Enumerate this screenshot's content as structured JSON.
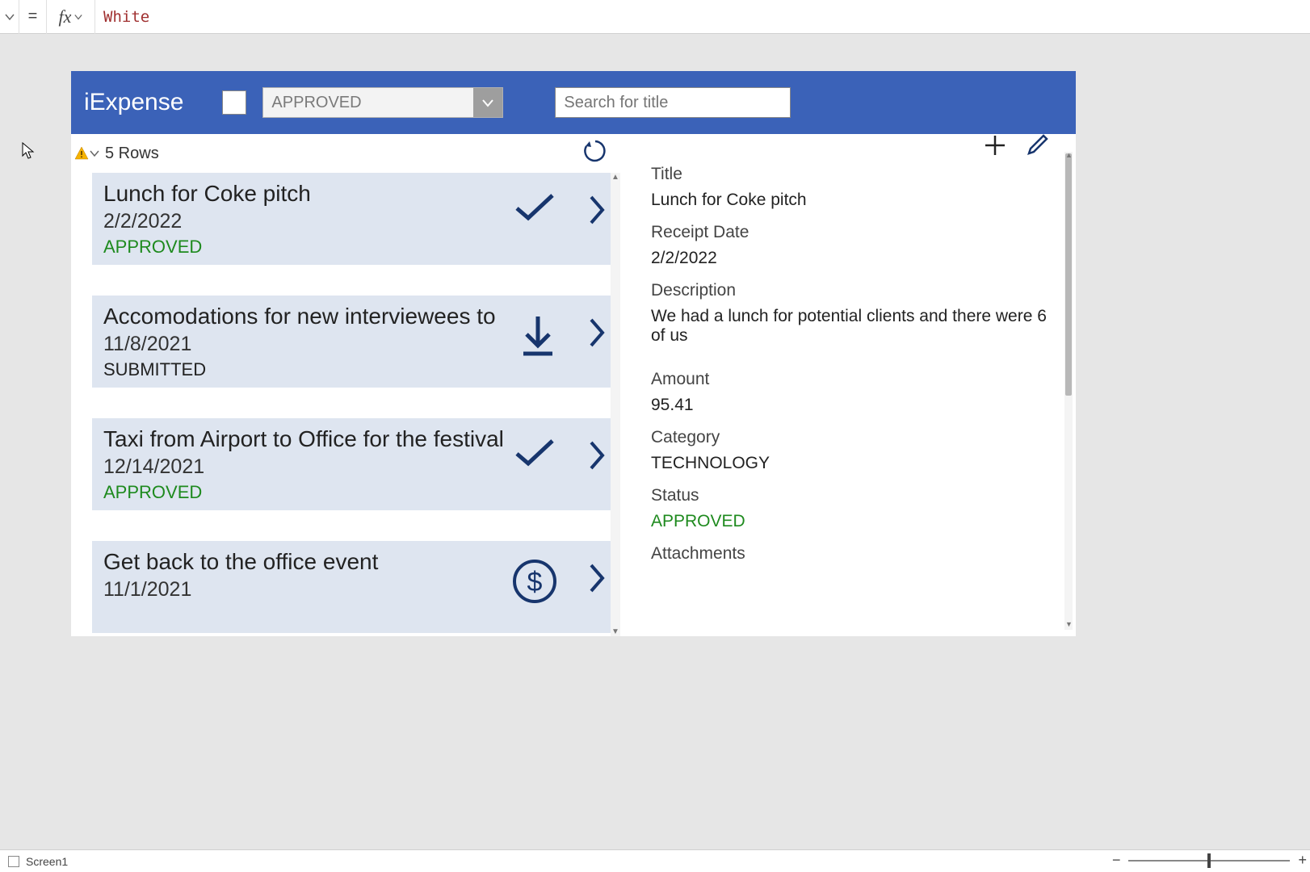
{
  "formula_bar": {
    "value": "White"
  },
  "app": {
    "title": "iExpense",
    "filter_dropdown": "APPROVED",
    "search_placeholder": "Search for title"
  },
  "list": {
    "rows_label": "5 Rows",
    "items": [
      {
        "title": "Lunch for Coke pitch",
        "date": "2/2/2022",
        "status": "APPROVED",
        "status_style": "approved",
        "icon": "check"
      },
      {
        "title": "Accomodations for new interviewees to",
        "date": "11/8/2021",
        "status": "SUBMITTED",
        "status_style": "default",
        "icon": "download"
      },
      {
        "title": "Taxi from Airport to Office for the festival",
        "date": "12/14/2021",
        "status": "APPROVED",
        "status_style": "approved",
        "icon": "check"
      },
      {
        "title": "Get back to the office event",
        "date": "11/1/2021",
        "status": "",
        "status_style": "default",
        "icon": "dollar"
      }
    ]
  },
  "detail": {
    "fields": {
      "title_label": "Title",
      "title_value": "Lunch for Coke pitch",
      "date_label": "Receipt Date",
      "date_value": "2/2/2022",
      "desc_label": "Description",
      "desc_value": "We had a lunch for potential clients and there were 6 of us",
      "amount_label": "Amount",
      "amount_value": "95.41",
      "category_label": "Category",
      "category_value": "TECHNOLOGY",
      "status_label": "Status",
      "status_value": "APPROVED",
      "attachments_label": "Attachments"
    }
  },
  "statusbar": {
    "screen": "Screen1"
  }
}
